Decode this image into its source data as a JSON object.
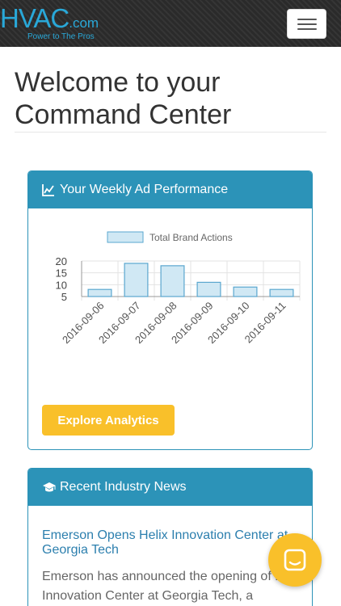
{
  "nav": {
    "brand_name": "HVAC",
    "brand_suffix": ".com",
    "brand_tagline": "Power to The Pros",
    "menu_icon": "hamburger-menu-icon"
  },
  "page": {
    "title": "Welcome to your Command Center"
  },
  "ad_panel": {
    "icon": "line-chart-icon",
    "heading": "Your Weekly Ad Performance",
    "button_label": "Explore Analytics"
  },
  "chart_data": {
    "type": "bar",
    "categories": [
      "2016-09-06",
      "2016-09-07",
      "2016-09-08",
      "2016-09-09",
      "2016-09-10",
      "2016-09-11"
    ],
    "series": [
      {
        "name": "Total Brand Actions",
        "values": [
          8,
          19,
          18,
          11,
          9,
          8
        ]
      }
    ],
    "y_ticks": [
      5,
      10,
      15,
      20
    ],
    "ylim": [
      5,
      20
    ],
    "legend": "top",
    "colors": {
      "fill": "#d0e8f4",
      "stroke": "#5aa7cf"
    }
  },
  "news_panel": {
    "icon": "graduation-cap-icon",
    "heading": "Recent Industry News",
    "article_title": "Emerson Opens Helix Innovation Center at Georgia Tech",
    "article_excerpt": "Emerson has announced the opening of Helix Innovation Center at Georgia Tech, a"
  },
  "chat": {
    "icon": "chat-icon"
  },
  "colors": {
    "accent": "#2c93b8",
    "button": "#f9c02a",
    "link": "#2c7fae"
  }
}
